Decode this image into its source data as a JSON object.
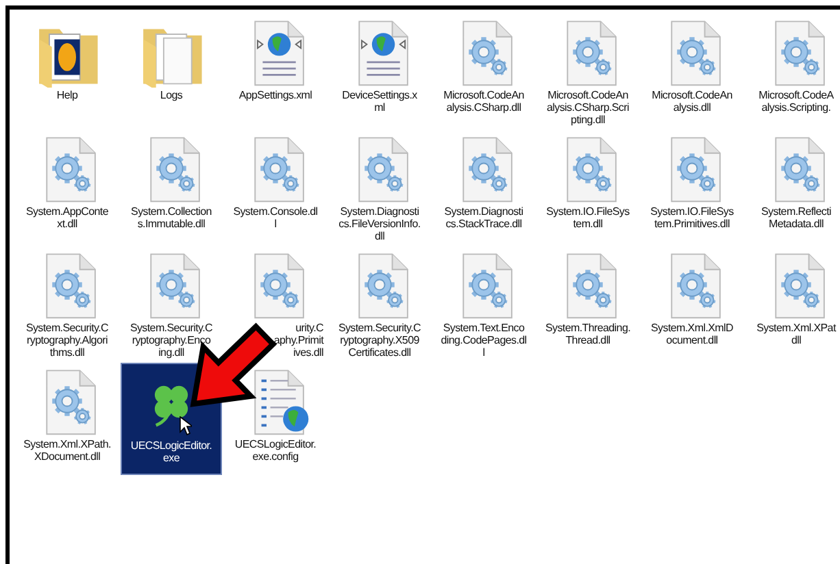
{
  "items": [
    {
      "kind": "folder-picture",
      "lines": [
        "Help"
      ],
      "selected": false
    },
    {
      "kind": "folder",
      "lines": [
        "Logs"
      ],
      "selected": false
    },
    {
      "kind": "xml",
      "lines": [
        "AppSettings.xml"
      ],
      "selected": false
    },
    {
      "kind": "xml",
      "lines": [
        "DeviceSettings.x",
        "ml"
      ],
      "selected": false
    },
    {
      "kind": "dll",
      "lines": [
        "Microsoft.CodeAn",
        "alysis.CSharp.dll"
      ],
      "selected": false
    },
    {
      "kind": "dll",
      "lines": [
        "Microsoft.CodeAn",
        "alysis.CSharp.Scri",
        "pting.dll"
      ],
      "selected": false
    },
    {
      "kind": "dll",
      "lines": [
        "Microsoft.CodeAn",
        "alysis.dll"
      ],
      "selected": false
    },
    {
      "kind": "dll",
      "lines": [
        "Microsoft.CodeA",
        "alysis.Scripting."
      ],
      "selected": false
    },
    {
      "kind": "dll",
      "lines": [
        "System.AppConte",
        "xt.dll"
      ],
      "selected": false
    },
    {
      "kind": "dll",
      "lines": [
        "System.Collection",
        "s.Immutable.dll"
      ],
      "selected": false
    },
    {
      "kind": "dll",
      "lines": [
        "System.Console.dl",
        "l"
      ],
      "selected": false
    },
    {
      "kind": "dll",
      "lines": [
        "System.Diagnosti",
        "cs.FileVersionInfo.",
        "dll"
      ],
      "selected": false
    },
    {
      "kind": "dll",
      "lines": [
        "System.Diagnosti",
        "cs.StackTrace.dll"
      ],
      "selected": false
    },
    {
      "kind": "dll",
      "lines": [
        "System.IO.FileSys",
        "tem.dll"
      ],
      "selected": false
    },
    {
      "kind": "dll",
      "lines": [
        "System.IO.FileSys",
        "tem.Primitives.dll"
      ],
      "selected": false
    },
    {
      "kind": "dll",
      "lines": [
        "System.Reflecti",
        "Metadata.dll"
      ],
      "selected": false
    },
    {
      "kind": "dll",
      "lines": [
        "System.Security.C",
        "ryptography.Algori",
        "thms.dll"
      ],
      "selected": false
    },
    {
      "kind": "dll",
      "lines": [
        "System.Security.C",
        "ryptography.Enco",
        "ing.dll"
      ],
      "selected": false
    },
    {
      "kind": "dll",
      "lines": [
        "urity.C",
        "aphy.Primit",
        "ives.dll"
      ],
      "selected": false,
      "partial": true
    },
    {
      "kind": "dll",
      "lines": [
        "System.Security.C",
        "ryptography.X509",
        "Certificates.dll"
      ],
      "selected": false
    },
    {
      "kind": "dll",
      "lines": [
        "System.Text.Enco",
        "ding.CodePages.dl",
        "l"
      ],
      "selected": false
    },
    {
      "kind": "dll",
      "lines": [
        "System.Threading.",
        "Thread.dll"
      ],
      "selected": false
    },
    {
      "kind": "dll",
      "lines": [
        "System.Xml.XmlD",
        "ocument.dll"
      ],
      "selected": false
    },
    {
      "kind": "dll",
      "lines": [
        "System.Xml.XPat",
        "dll"
      ],
      "selected": false
    },
    {
      "kind": "dll",
      "lines": [
        "System.Xml.XPath.",
        "XDocument.dll"
      ],
      "selected": false
    },
    {
      "kind": "exe",
      "lines": [
        "UECSLogicEditor.",
        "exe"
      ],
      "selected": true
    },
    {
      "kind": "config",
      "lines": [
        "UECSLogicEditor.",
        "exe.config"
      ],
      "selected": false
    }
  ]
}
